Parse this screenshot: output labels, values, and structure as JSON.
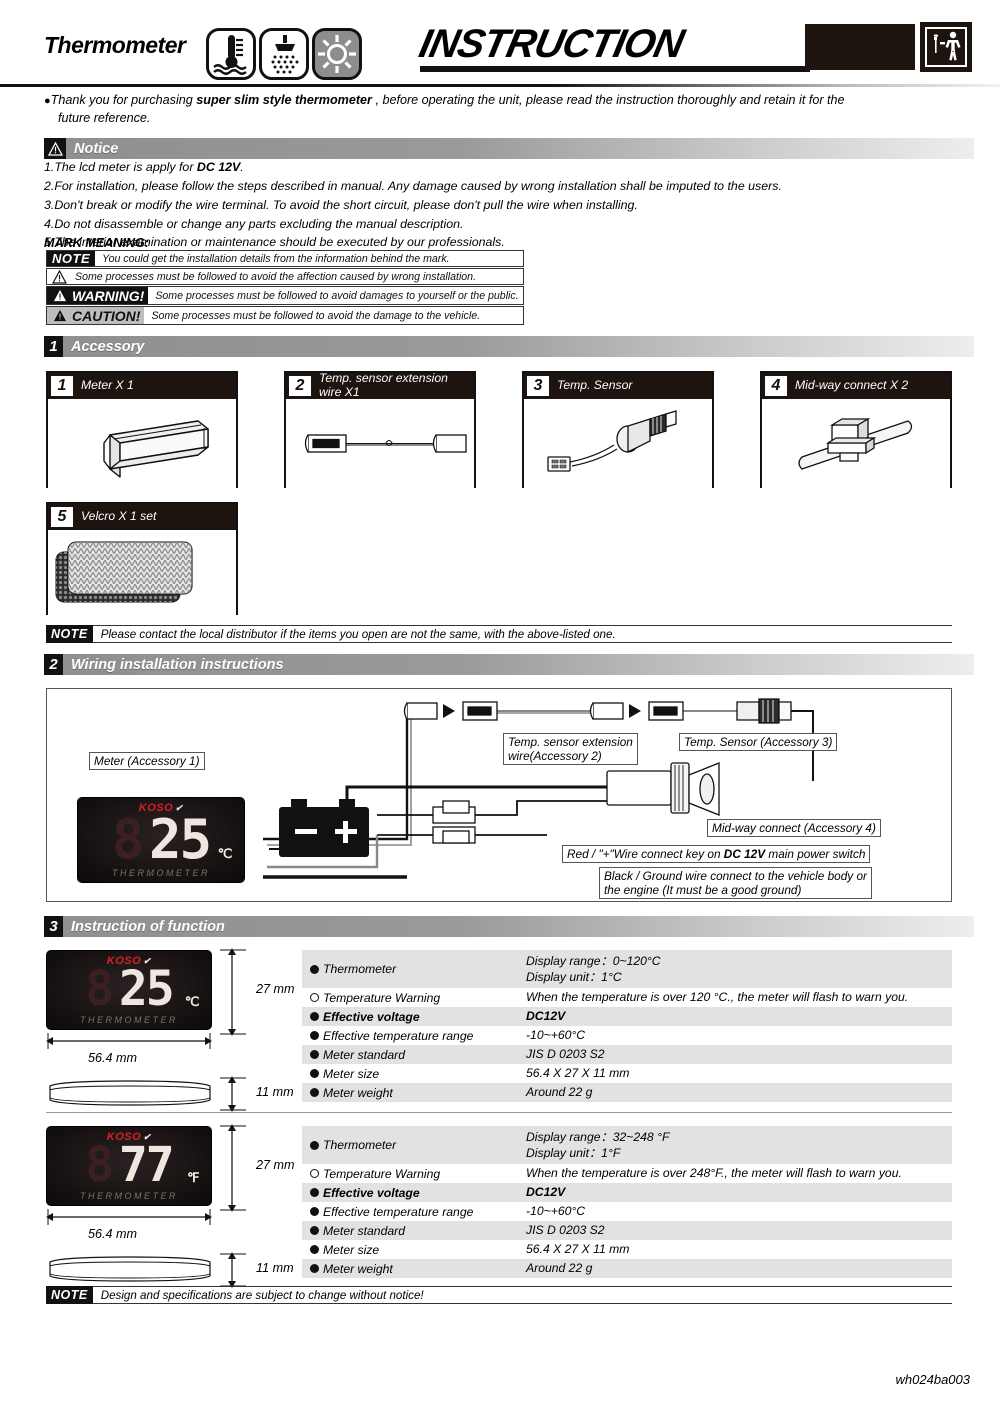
{
  "header": {
    "brand_word": "Thermometer",
    "title": "INSTRUCTION",
    "icons": [
      "water-thermometer-icon",
      "shower-waterproof-icon",
      "sun-backlight-icon"
    ],
    "badge_icon": "worker-tools-icon"
  },
  "intro": {
    "line1_a": "Thank you for purchasing ",
    "line1_b": "super slim style thermometer",
    "line1_c": " , before operating the unit, please read the instruction thoroughly and retain it for the",
    "line2": "future reference."
  },
  "notice": {
    "bar_label": "Notice",
    "items": [
      {
        "n": "1.",
        "text_a": "The lcd meter is apply for ",
        "bold": "DC 12V",
        "text_b": "."
      },
      {
        "n": "2.",
        "text_a": "For installation, please follow the steps described in manual. Any damage caused by wrong installation shall be imputed to the users.",
        "bold": "",
        "text_b": ""
      },
      {
        "n": "3.",
        "text_a": "Don't break or modify the wire terminal. To avoid the short circuit, please don't pull the wire when installing.",
        "bold": "",
        "text_b": ""
      },
      {
        "n": "4.",
        "text_a": "Do not disassemble or change any parts excluding the manual description.",
        "bold": "",
        "text_b": ""
      },
      {
        "n": "5.",
        "text_a": "The interior examination or maintenance should be executed by our professionals.",
        "bold": "",
        "text_b": ""
      }
    ]
  },
  "mark_meaning": {
    "title": "MARK MEANING:",
    "rows": [
      {
        "tag": "NOTE",
        "style": "note",
        "text": "You could get the installation details from the information behind the mark."
      },
      {
        "tag": "",
        "style": "triangle",
        "text": "Some processes must be followed to avoid the affection caused by wrong installation."
      },
      {
        "tag": "WARNING!",
        "style": "warning",
        "text": "Some processes must be followed to avoid damages to yourself or the public."
      },
      {
        "tag": "CAUTION!",
        "style": "caution",
        "text": "Some processes must be followed to avoid the damage to the vehicle."
      }
    ]
  },
  "accessory": {
    "section_num": "1",
    "section_label": "Accessory",
    "items": [
      {
        "num": "1",
        "label": "Meter X 1",
        "image": "meter-3d-icon"
      },
      {
        "num": "2",
        "label": "Temp. sensor extension\nwire X1",
        "label_l1": "Temp. sensor extension",
        "label_l2": "wire X1",
        "image": "extension-wire-icon"
      },
      {
        "num": "3",
        "label": "Temp. Sensor",
        "image": "temp-sensor-icon"
      },
      {
        "num": "4",
        "label": "Mid-way connect X 2",
        "image": "midway-connector-icon"
      },
      {
        "num": "5",
        "label": "Velcro X 1 set",
        "image": "velcro-pads-icon"
      }
    ],
    "note_tag": "NOTE",
    "note_text": "Please contact the local distributor if the items you open are not the same, with the above-listed one."
  },
  "wiring": {
    "section_num": "2",
    "section_label": "Wiring installation instructions",
    "callouts": {
      "meter": "Meter (Accessory 1)",
      "ext_wire_l1": "Temp. sensor extension",
      "ext_wire_l2": "wire(Accessory 2)",
      "sensor": "Temp. Sensor (Accessory 3)",
      "midway": "Mid-way connect (Accessory 4)",
      "red_a": "Red / \"+\"Wire connect key on ",
      "red_bold": "DC 12V",
      "red_b": " main power switch",
      "black_l1": "Black / Ground wire connect to the vehicle body or",
      "black_l2": "the engine (It must be a good ground)"
    },
    "meter_display": {
      "brand": "KOSO",
      "ghost": "8",
      "value": "25",
      "unit": "℃",
      "word": "THERMOMETER"
    }
  },
  "function": {
    "section_num": "3",
    "section_label": "Instruction of function",
    "note_tag": "NOTE",
    "note_text": "Design and specifications are subject to change without notice!",
    "blocks": [
      {
        "meter": {
          "brand": "KOSO",
          "ghost": "8",
          "value": "25",
          "unit": "℃",
          "word": "THERMOMETER"
        },
        "dims": {
          "height": "27 mm",
          "width": "56.4 mm",
          "depth": "11 mm"
        },
        "rows": [
          {
            "key": "Thermometer",
            "bullet": "full",
            "bold": false,
            "values": [
              "Display range：0~120°C",
              "Display unit：1°C"
            ]
          },
          {
            "key": "Temperature Warning",
            "bullet": "open",
            "bold": false,
            "values": [
              "When the temperature is over 120 °C., the meter will flash to warn you."
            ]
          },
          {
            "key": "Effective voltage",
            "bullet": "full",
            "bold": true,
            "values": [
              "DC12V"
            ]
          },
          {
            "key": "Effective temperature range",
            "bullet": "full",
            "bold": false,
            "values": [
              "-10~+60°C"
            ]
          },
          {
            "key": "Meter standard",
            "bullet": "full",
            "bold": false,
            "values": [
              "JIS D 0203 S2"
            ]
          },
          {
            "key": "Meter size",
            "bullet": "full",
            "bold": false,
            "values": [
              "56.4 X 27 X 11 mm"
            ]
          },
          {
            "key": "Meter weight",
            "bullet": "full",
            "bold": false,
            "values": [
              "Around 22 g"
            ]
          }
        ]
      },
      {
        "meter": {
          "brand": "KOSO",
          "ghost": "8",
          "value": "77",
          "unit": "℉",
          "word": "THERMOMETER"
        },
        "dims": {
          "height": "27 mm",
          "width": "56.4 mm",
          "depth": "11 mm"
        },
        "rows": [
          {
            "key": "Thermometer",
            "bullet": "full",
            "bold": false,
            "values": [
              "Display range：32~248 °F",
              "Display unit：1°F"
            ]
          },
          {
            "key": "Temperature Warning",
            "bullet": "open",
            "bold": false,
            "values": [
              "When the temperature is over 248°F., the meter will flash to warn you."
            ]
          },
          {
            "key": "Effective voltage",
            "bullet": "full",
            "bold": true,
            "values": [
              "DC12V"
            ]
          },
          {
            "key": "Effective temperature range",
            "bullet": "full",
            "bold": false,
            "values": [
              "-10~+60°C"
            ]
          },
          {
            "key": "Meter standard",
            "bullet": "full",
            "bold": false,
            "values": [
              "JIS D 0203 S2"
            ]
          },
          {
            "key": "Meter size",
            "bullet": "full",
            "bold": false,
            "values": [
              "56.4 X 27 X 11 mm"
            ]
          },
          {
            "key": "Meter weight",
            "bullet": "full",
            "bold": false,
            "values": [
              "Around 22 g"
            ]
          }
        ]
      }
    ]
  },
  "footer": {
    "code": "wh024ba003"
  }
}
